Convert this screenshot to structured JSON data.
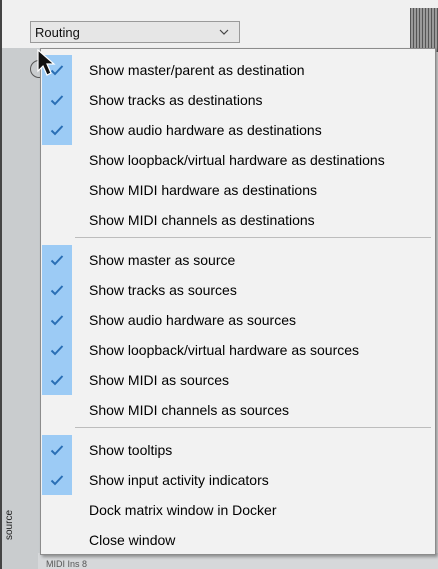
{
  "dropdown": {
    "value": "Routing"
  },
  "side_label": "source",
  "bottom_ghost_text": "MIDI Ins 8",
  "colors": {
    "check_bg": "#9ccbf5",
    "check_mark": "#2a6fb5",
    "menu_bg": "#f2f2f2"
  },
  "menu": {
    "items": [
      {
        "label": "Show master/parent as destination",
        "checked": true
      },
      {
        "label": "Show tracks as destinations",
        "checked": true
      },
      {
        "label": "Show audio hardware as destinations",
        "checked": true
      },
      {
        "label": "Show loopback/virtual hardware as destinations",
        "checked": false
      },
      {
        "label": "Show MIDI hardware as destinations",
        "checked": false
      },
      {
        "label": "Show MIDI channels as destinations",
        "checked": false
      },
      {
        "label": "Show master as source",
        "checked": true
      },
      {
        "label": "Show tracks as sources",
        "checked": true
      },
      {
        "label": "Show audio hardware as sources",
        "checked": true
      },
      {
        "label": "Show loopback/virtual hardware as sources",
        "checked": true
      },
      {
        "label": "Show MIDI as sources",
        "checked": true
      },
      {
        "label": "Show MIDI channels as sources",
        "checked": false
      },
      {
        "label": "Show tooltips",
        "checked": true
      },
      {
        "label": "Show input activity indicators",
        "checked": true
      },
      {
        "label": "Dock matrix window in Docker",
        "checked": false
      },
      {
        "label": "Close window",
        "checked": false
      }
    ]
  }
}
